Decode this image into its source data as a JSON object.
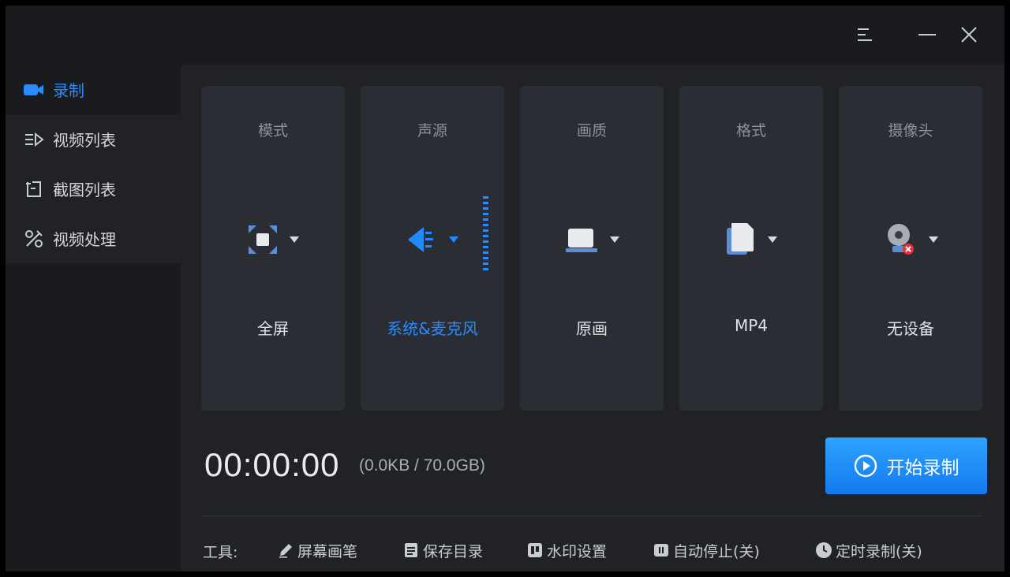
{
  "colors": {
    "accent": "#2a8cff",
    "window_bg": "#202226",
    "panel_bg": "#1a1b1e",
    "card_bg": "#2a2d33"
  },
  "titlebar": {
    "icons": [
      "menu-icon",
      "minimize-icon",
      "close-icon"
    ]
  },
  "sidebar": {
    "items": [
      {
        "label": "录制",
        "icon": "video-camera-icon",
        "active": true
      },
      {
        "label": "视频列表",
        "icon": "video-list-icon",
        "active": false
      },
      {
        "label": "截图列表",
        "icon": "screenshot-list-icon",
        "active": false
      },
      {
        "label": "视频处理",
        "icon": "video-edit-icon",
        "active": false
      }
    ]
  },
  "cards": [
    {
      "title": "模式",
      "value": "全屏",
      "icon": "fullscreen-icon"
    },
    {
      "title": "声源",
      "value": "系统&麦克风",
      "icon": "speaker-icon"
    },
    {
      "title": "画质",
      "value": "原画",
      "icon": "monitor-icon"
    },
    {
      "title": "格式",
      "value": "MP4",
      "icon": "file-icon"
    },
    {
      "title": "摄像头",
      "value": "无设备",
      "icon": "webcam-icon"
    }
  ],
  "recording": {
    "timer": "00:00:00",
    "storage": "(0.0KB / 70.0GB)",
    "start_label": "开始录制"
  },
  "toolbar": {
    "label": "工具:",
    "items": [
      {
        "label": "屏幕画笔",
        "icon": "pen-icon"
      },
      {
        "label": "保存目录",
        "icon": "folder-doc-icon"
      },
      {
        "label": "水印设置",
        "icon": "watermark-icon"
      },
      {
        "label": "自动停止(关)",
        "icon": "pause-icon"
      },
      {
        "label": "定时录制(关)",
        "icon": "clock-icon"
      }
    ]
  }
}
